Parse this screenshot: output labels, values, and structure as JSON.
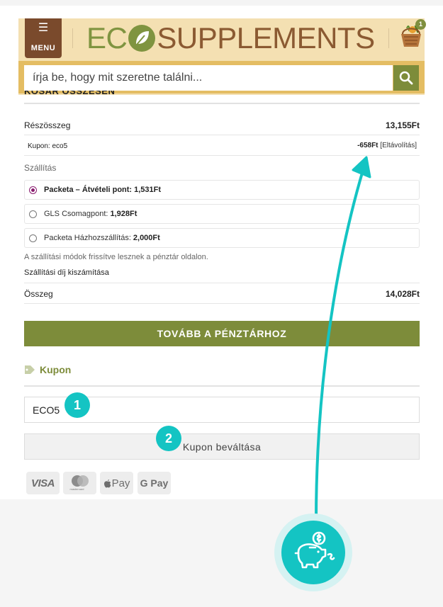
{
  "header": {
    "menu_label": "MENU",
    "logo_text_left": "EC",
    "logo_text_right": "SUPPLEMENTS",
    "cart_count": "1"
  },
  "search": {
    "placeholder": "írja be, hogy mit szeretne találni..."
  },
  "cart_totals": {
    "section_title": "KOSÁR ÖSSZESEN",
    "subtotal_label": "Részösszeg",
    "subtotal_value": "13,155Ft",
    "coupon_label": "Kupon: eco5",
    "coupon_value": "-658Ft",
    "coupon_remove": "[Eltávolítás]",
    "shipping_label": "Szállítás",
    "shipping_options": [
      {
        "name": "Packeta – Átvételi pont:",
        "price": "1,531Ft",
        "selected": true
      },
      {
        "name": "GLS Csomagpont:",
        "price": "1,928Ft",
        "selected": false
      },
      {
        "name": "Packeta Házhozszállítás:",
        "price": "2,000Ft",
        "selected": false
      }
    ],
    "shipping_note": "A szállítási módok frissítve lesznek a pénztár oldalon.",
    "shipping_calc": "Szállítási díj kiszámítása",
    "total_label": "Összeg",
    "total_value": "14,028Ft"
  },
  "checkout_button": "TOVÁBB A PÉNZTÁRHOZ",
  "coupon": {
    "title": "Kupon",
    "input_value": "ECO5",
    "apply_button": "Kupon beváltása"
  },
  "steps": [
    "1",
    "2"
  ],
  "payment_methods": [
    "VISA",
    "mastercard",
    "Pay",
    "G Pay"
  ],
  "colors": {
    "brand_green": "#7d8c3a",
    "header_bg": "#f4e0b2",
    "search_border": "#e4bd63",
    "accent_teal": "#14c4c3",
    "menu_brown": "#7a4a2c",
    "radio_selected": "#8a1c6f"
  },
  "icons": {
    "menu": "hamburger-icon",
    "logo_leaf": "leaf-icon",
    "cart": "basket-icon",
    "search": "search-icon",
    "coupon": "tag-icon",
    "savings": "piggy-bank-icon"
  }
}
